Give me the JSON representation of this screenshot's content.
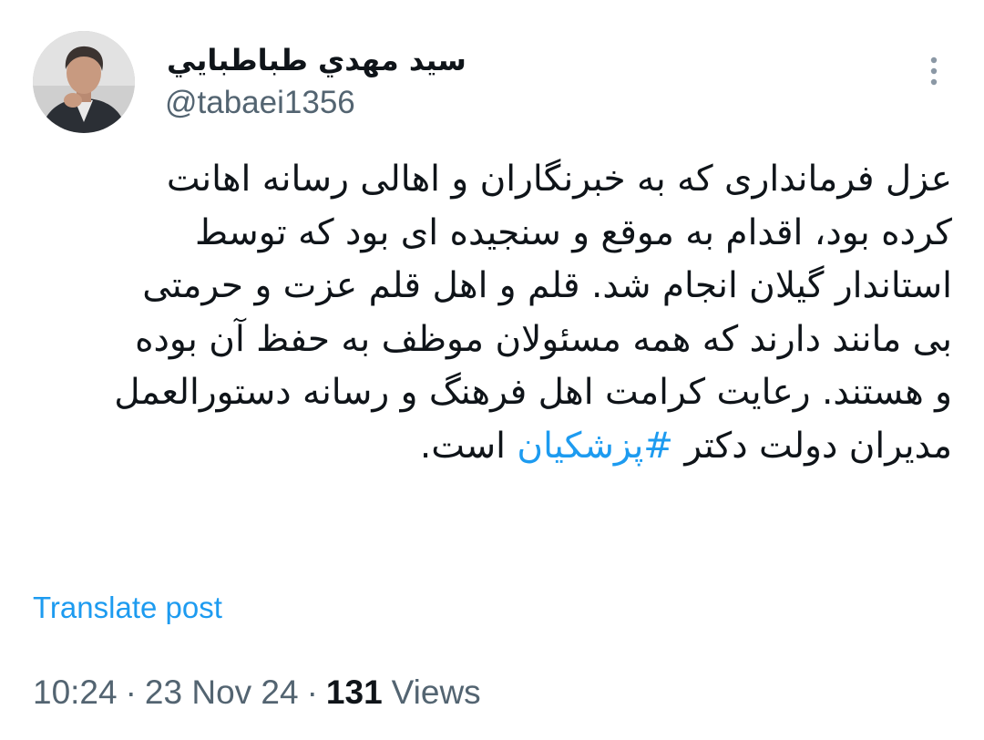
{
  "author": {
    "display_name": "سيد مهدي طباطبايي",
    "handle": "@tabaei1356",
    "avatar_icon": "profile-photo"
  },
  "menu": {
    "icon": "more-vertical-icon"
  },
  "tweet": {
    "lines": [
      "عزل فرمانداری که به خبرنگاران و اهالی رسانه اهانت",
      "کرده بود، اقدام به موقع و سنجیده ای بود که توسط",
      "استاندار گیلان انجام شد. قلم و اهل قلم عزت و حرمتی",
      "بی مانند دارند که همه مسئولان موظف به حفظ آن بوده",
      "و هستند. رعایت کرامت اهل فرهنگ و رسانه دستورالعمل"
    ],
    "last_line_before": "مدیران دولت دکتر ",
    "hashtag": "#پزشکیان",
    "last_line_after": " است."
  },
  "translate_label": "Translate post",
  "meta": {
    "time": "10:24",
    "date": "23 Nov 24",
    "separator": "·",
    "views_count": "131",
    "views_label": "Views"
  },
  "colors": {
    "text": "#0f1419",
    "secondary": "#536471",
    "link": "#1d9bf0"
  }
}
